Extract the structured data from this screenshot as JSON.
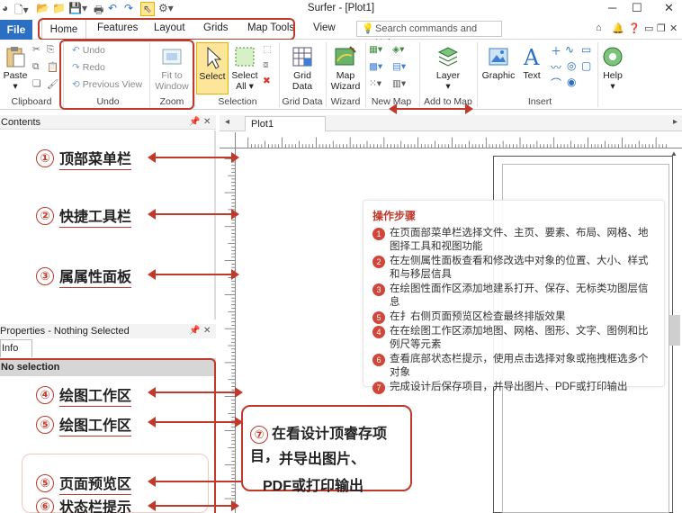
{
  "window": {
    "title": "Surfer - [Plot1]",
    "minimize": "─",
    "maximize": "☐",
    "close": "✕"
  },
  "tabs": {
    "file": "File",
    "items": [
      "Home",
      "Features",
      "Layout",
      "Grids",
      "Map Tools",
      "View"
    ]
  },
  "search": {
    "placeholder": "Search commands and Hel..."
  },
  "ribbon": {
    "paste": "Paste",
    "undo": "Undo",
    "redo": "Redo",
    "previous_view": "Previous View",
    "fit_to_window": [
      "Fit to",
      "Window"
    ],
    "select": "Select",
    "select_all": [
      "Select",
      "All ▾"
    ],
    "grid_data": [
      "Grid",
      "Data"
    ],
    "map_wizard": [
      "Map",
      "Wizard"
    ],
    "layer": [
      "Layer",
      "▾"
    ],
    "graphic": "Graphic",
    "text": "Text",
    "help": [
      "Help",
      "▾"
    ],
    "groups": [
      "Clipboard",
      "Undo",
      "Zoom",
      "Selection",
      "Grid Data",
      "Wizard",
      "New Map",
      "Add to Map",
      "Insert"
    ]
  },
  "panels": {
    "contents": "Contents",
    "properties": "Properties - Nothing Selected",
    "info_tab": "Info",
    "no_selection": "No selection",
    "pin": "ᵠ",
    "close": "✕"
  },
  "document": {
    "tab": "Plot1",
    "nav_left": "◂",
    "nav_right": "▸"
  },
  "annotations": [
    {
      "num": "①",
      "text": "顶部菜单栏"
    },
    {
      "num": "②",
      "text": "快捷工具栏"
    },
    {
      "num": "③",
      "text": "属属性面板"
    },
    {
      "num": "④",
      "text": "绘图工作区"
    },
    {
      "num": "⑤",
      "text": "绘图工作区"
    },
    {
      "num": "⑤",
      "text": "页面预览区"
    },
    {
      "num": "⑥",
      "text": "状态栏提示"
    }
  ],
  "steps": {
    "title": "操作步骤",
    "items": [
      {
        "num": "1",
        "text": "在页面部菜单栏选择文件、主页、要素、布局、网格、地图择工具和视图功能"
      },
      {
        "num": "2",
        "text": "在左侧属性面板查看和修改选中对象的位置、大小、样式和与移层信具"
      },
      {
        "num": "3",
        "text": "在绘图性面作区添加地建系打开、保存、无标类功图层信息"
      },
      {
        "num": "5",
        "text": "在扌右侧页面预览区检查最终排版效果"
      },
      {
        "num": "4",
        "text": "在在绘图工作区添加地图、网格、图形、文字、图例和比例尺等元素"
      },
      {
        "num": "6",
        "text": "查看底部状态栏提示，使用点击选择对象或拖拽框选多个对象"
      },
      {
        "num": "7",
        "text": "完成设计后保存项目，并导出图片、PDF或打印输出"
      }
    ]
  },
  "callout": {
    "num": "⑦",
    "line1": "在看设计顶睿存项目，",
    "line2": "并导出图片、",
    "line3": "PDF或打印输出"
  },
  "colors": {
    "accent": "#c0392b",
    "file_tab": "#2b6fc2",
    "select_highlight": "#fde69a"
  }
}
